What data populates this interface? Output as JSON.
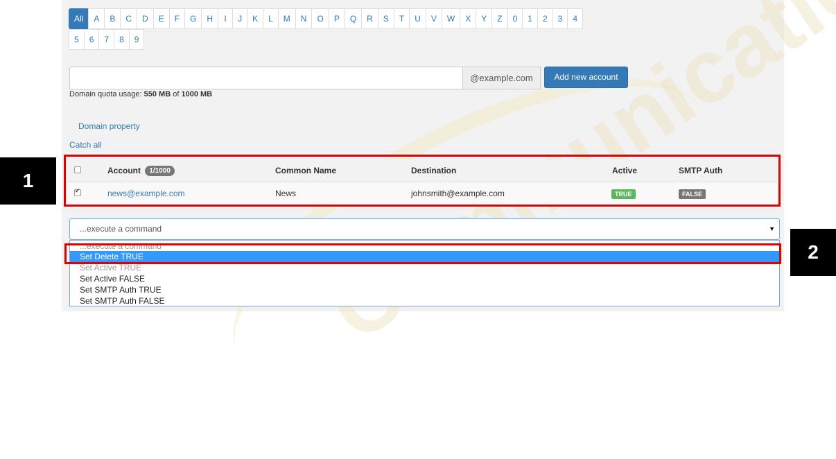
{
  "pager": {
    "row1": [
      "All",
      "A",
      "B",
      "C",
      "D",
      "E",
      "F",
      "G",
      "H",
      "I",
      "J",
      "K",
      "L",
      "M",
      "N",
      "O",
      "P",
      "Q",
      "R",
      "S",
      "T",
      "U",
      "V",
      "W",
      "X",
      "Y",
      "Z",
      "0",
      "1",
      "2",
      "3",
      "4"
    ],
    "row2": [
      "5",
      "6",
      "7",
      "8",
      "9"
    ]
  },
  "new_account": {
    "input_value": "",
    "domain_suffix": "@example.com",
    "add_button": "Add new account"
  },
  "quota": {
    "prefix": "Domain quota usage:",
    "used": "550 MB",
    "of": "of",
    "total": "1000 MB"
  },
  "links": {
    "domain_property": "Domain property",
    "catch_all": "Catch all"
  },
  "table": {
    "headers": {
      "account": "Account",
      "account_badge": "1/1000",
      "common_name": "Common Name",
      "destination": "Destination",
      "active": "Active",
      "smtp_auth": "SMTP Auth"
    },
    "rows": [
      {
        "checked": true,
        "account": "news@example.com",
        "common_name": "News",
        "destination": "johnsmith@example.com",
        "active": "TRUE",
        "smtp_auth": "FALSE"
      }
    ]
  },
  "command": {
    "selected": "...execute a command",
    "options": [
      "...execute a command",
      "Set Delete TRUE",
      "Set Active TRUE",
      "Set Active FALSE",
      "Set SMTP Auth TRUE",
      "Set SMTP Auth FALSE"
    ],
    "highlighted": "Set Delete TRUE"
  },
  "annotations": {
    "marker1": "1",
    "marker2": "2",
    "highlight_color": "#e00000"
  },
  "watermark": "Communication."
}
